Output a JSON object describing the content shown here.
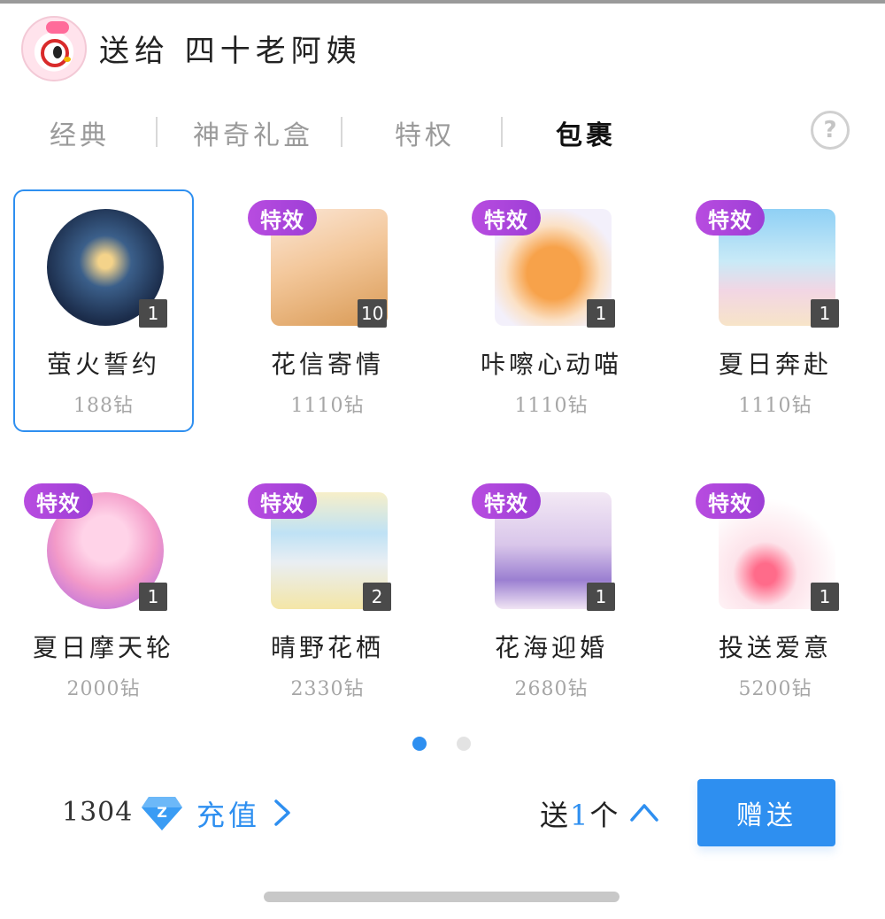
{
  "header": {
    "title": "送给 四十老阿姨",
    "avatar": "hello-kitty-avatar"
  },
  "tabs": [
    {
      "label": "经典",
      "active": false
    },
    {
      "label": "神奇礼盒",
      "active": false
    },
    {
      "label": "特权",
      "active": false
    },
    {
      "label": "包裹",
      "active": true
    }
  ],
  "help_icon": "?",
  "fx_label": "特效",
  "gifts": [
    {
      "name": "萤火誓约",
      "price": "188钻",
      "qty": "1",
      "fx": false,
      "selected": true
    },
    {
      "name": "花信寄情",
      "price": "1110钻",
      "qty": "10",
      "fx": true,
      "selected": false
    },
    {
      "name": "咔嚓心动喵",
      "price": "1110钻",
      "qty": "1",
      "fx": true,
      "selected": false
    },
    {
      "name": "夏日奔赴",
      "price": "1110钻",
      "qty": "1",
      "fx": true,
      "selected": false
    },
    {
      "name": "夏日摩天轮",
      "price": "2000钻",
      "qty": "1",
      "fx": true,
      "selected": false
    },
    {
      "name": "晴野花栖",
      "price": "2330钻",
      "qty": "2",
      "fx": true,
      "selected": false
    },
    {
      "name": "花海迎婚",
      "price": "2680钻",
      "qty": "1",
      "fx": true,
      "selected": false
    },
    {
      "name": "投送爱意",
      "price": "5200钻",
      "qty": "1",
      "fx": true,
      "selected": false
    }
  ],
  "pagination": {
    "current": 1,
    "total": 2
  },
  "footer": {
    "balance": "1304",
    "currency_icon": "diamond-icon",
    "recharge_label": "充值",
    "send_prefix": "送",
    "send_count": "1",
    "send_suffix": "个",
    "send_button": "赠送"
  },
  "colors": {
    "accent": "#2e8ff0",
    "fx_badge": "#a845da",
    "qty_badge": "#4a4a4a"
  }
}
